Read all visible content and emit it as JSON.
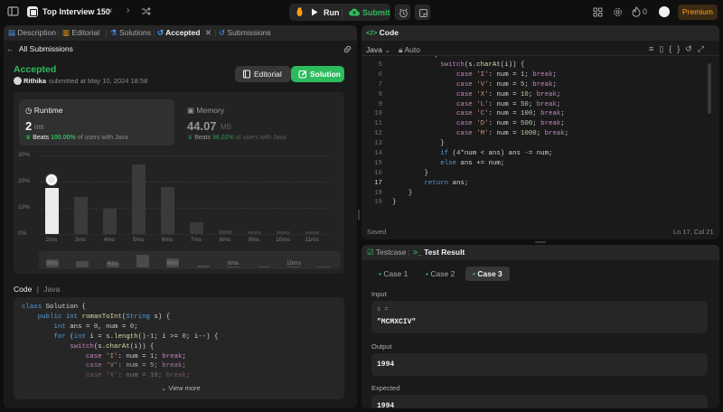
{
  "topbar": {
    "title": "Top Interview 150",
    "run_label": "Run",
    "submit_label": "Submit",
    "streak_count": "0",
    "premium_label": "Premium"
  },
  "left_tabs": [
    {
      "label": "Description"
    },
    {
      "label": "Editorial"
    },
    {
      "label": "Solutions"
    },
    {
      "label": "Accepted"
    },
    {
      "label": "Submissions"
    }
  ],
  "submission": {
    "back_label": "All Submissions",
    "status": "Accepted",
    "user": "Rithika",
    "submitted_text": "submitted at May 10, 2024 18:58",
    "editorial_button": "Editorial",
    "solution_button": "Solution"
  },
  "runtime": {
    "label": "Runtime",
    "value": "2",
    "unit": "ms",
    "beats_label": "Beats",
    "beats_pct": "100.00%",
    "beats_suffix": "of users with Java"
  },
  "memory": {
    "label": "Memory",
    "value": "44.07",
    "unit": "MB",
    "beats_label": "Beats",
    "beats_pct": "96.02%",
    "beats_suffix": "of users with Java"
  },
  "chart_data": {
    "type": "bar",
    "categories": [
      "2ms",
      "3ms",
      "4ms",
      "5ms",
      "6ms",
      "7ms",
      "8ms",
      "9ms",
      "10ms",
      "11ms"
    ],
    "values": [
      17.5,
      14,
      9.5,
      26.5,
      18,
      4.5,
      1.5,
      1,
      1,
      1
    ],
    "yticks": [
      "30%",
      "20%",
      "10%",
      "0%"
    ],
    "ylim": [
      0,
      30
    ],
    "highlight": "2ms",
    "minimap_labels": [
      "2ms",
      "4ms",
      "6ms",
      "8ms",
      "10ms"
    ]
  },
  "code_section": {
    "label": "Code",
    "lang": "Java",
    "view_more": "View more",
    "lines": [
      "class Solution {",
      "    public int romanToInt(String s) {",
      "        int ans = 0, num = 0;",
      "        for (int i = s.length()-1; i >= 0; i--) {",
      "            switch(s.charAt(i)) {",
      "                case 'I': num = 1; break;",
      "                case 'V': num = 5; break;",
      "                case 'X': num = 10; break;"
    ]
  },
  "editor": {
    "title": "Code",
    "language": "Java",
    "auto_label": "Auto",
    "status_left": "Saved",
    "cursor": "Ln 17, Col 21",
    "lines": [
      {
        "n": "5",
        "t": "            switch(s.charAt(i)) {"
      },
      {
        "n": "6",
        "t": "                case 'I': num = 1; break;"
      },
      {
        "n": "7",
        "t": "                case 'V': num = 5; break;"
      },
      {
        "n": "8",
        "t": "                case 'X': num = 10; break;"
      },
      {
        "n": "9",
        "t": "                case 'L': num = 50; break;"
      },
      {
        "n": "10",
        "t": "                case 'C': num = 100; break;"
      },
      {
        "n": "11",
        "t": "                case 'D': num = 500; break;"
      },
      {
        "n": "12",
        "t": "                case 'M': num = 1000; break;"
      },
      {
        "n": "13",
        "t": "            }"
      },
      {
        "n": "14",
        "t": "            if (4*num < ans) ans -= num;"
      },
      {
        "n": "15",
        "t": "            else ans += num;"
      },
      {
        "n": "16",
        "t": "        }"
      },
      {
        "n": "17",
        "t": "        return ans;"
      },
      {
        "n": "18",
        "t": "    }"
      },
      {
        "n": "19",
        "t": "}"
      }
    ]
  },
  "testpanel": {
    "tab_testcase": "Testcase",
    "tab_result": "Test Result",
    "cases": [
      "Case 1",
      "Case 2",
      "Case 3"
    ],
    "input_label": "Input",
    "input_var": "s =",
    "input_value": "\"MCMXCIV\"",
    "output_label": "Output",
    "output_value": "1994",
    "expected_label": "Expected",
    "expected_value": "1994"
  },
  "colors": {
    "accent_green": "#2cbb5d",
    "premium_orange": "#ffa116",
    "active_tab_blue": "#4a9eff"
  }
}
